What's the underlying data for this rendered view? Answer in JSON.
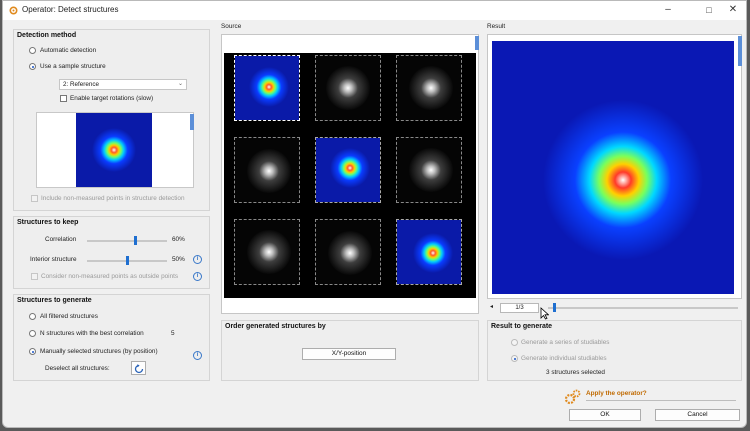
{
  "window": {
    "title": "Operator: Detect structures"
  },
  "detection": {
    "heading": "Detection method",
    "automatic": "Automatic detection",
    "sample": "Use a sample structure",
    "dropdown_value": "2: Reference",
    "enable_rotations": "Enable target rotations (slow)",
    "include_nonmeasured": "Include non-measured points in structure detection"
  },
  "keep": {
    "heading": "Structures to keep",
    "correlation_label": "Correlation",
    "correlation_value": "60%",
    "correlation_level": 0.6,
    "interior_label": "Interior structure",
    "interior_value": "50%",
    "interior_level": 0.5,
    "consider_outside": "Consider non-measured points as outside points"
  },
  "generate": {
    "heading": "Structures to generate",
    "all_filtered": "All filtered structures",
    "n_best": "N structures with the best correlation",
    "n_value": "5",
    "manual": "Manually selected structures (by position)",
    "deselect": "Deselect all structures:"
  },
  "source": {
    "label": "Source"
  },
  "result": {
    "label": "Result",
    "page": "1/3"
  },
  "order": {
    "heading": "Order generated structures by",
    "button": "X/Y-position"
  },
  "result_gen": {
    "heading": "Result to generate",
    "series": "Generate a series of studiables",
    "individual": "Generate individual studiables",
    "selected_count": "3 structures selected"
  },
  "apply": {
    "prompt": "Apply the operator?",
    "ok": "OK",
    "cancel": "Cancel"
  },
  "colors": {
    "accent": "#1f6fd0",
    "apply_text": "#c06a00",
    "gear": "#e08a1e"
  }
}
